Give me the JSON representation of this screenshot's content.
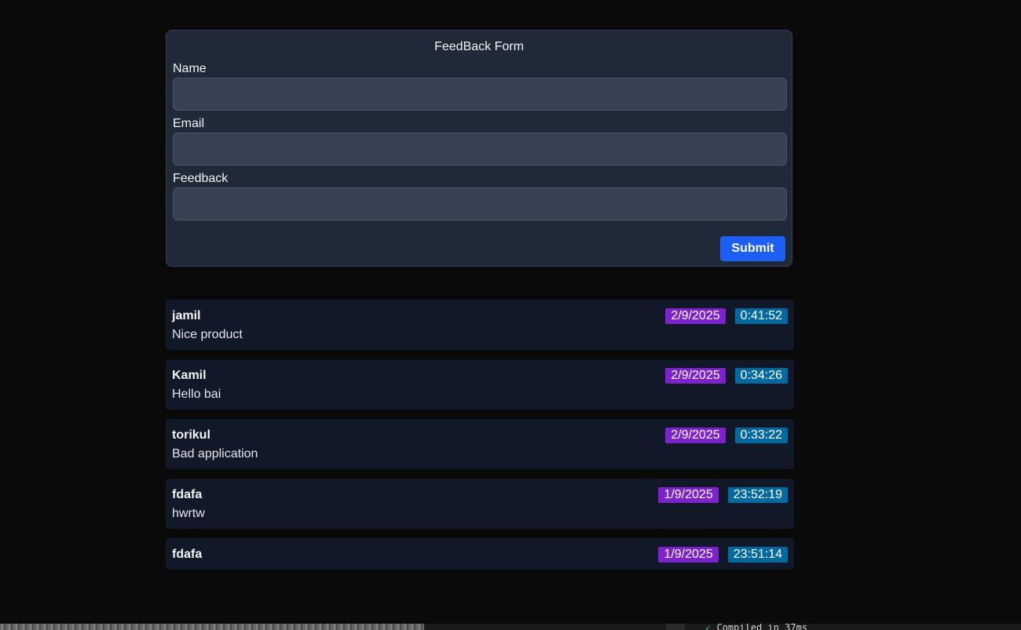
{
  "form": {
    "title": "FeedBack Form",
    "fields": [
      {
        "label": "Name",
        "value": ""
      },
      {
        "label": "Email",
        "value": ""
      },
      {
        "label": "Feedback",
        "value": ""
      }
    ],
    "submit_label": "Submit",
    "colors": {
      "card": "#1f2937",
      "input": "#374151",
      "button": "#1d5ff5"
    }
  },
  "feedback": [
    {
      "name": "jamil",
      "message": "Nice product",
      "date": "2/9/2025",
      "time": "0:41:52"
    },
    {
      "name": "Kamil",
      "message": "Hello bai",
      "date": "2/9/2025",
      "time": "0:34:26"
    },
    {
      "name": "torikul",
      "message": "Bad application",
      "date": "2/9/2025",
      "time": "0:33:22"
    },
    {
      "name": "fdafa",
      "message": "hwrtw",
      "date": "1/9/2025",
      "time": "23:52:19"
    },
    {
      "name": "fdafa",
      "message": "",
      "date": "1/9/2025",
      "time": "23:51:14"
    }
  ],
  "badge_colors": {
    "date": "#7e22ce",
    "time": "#0369a1"
  },
  "terminal": {
    "check": "✓",
    "text": "Compiled in 37ms"
  }
}
